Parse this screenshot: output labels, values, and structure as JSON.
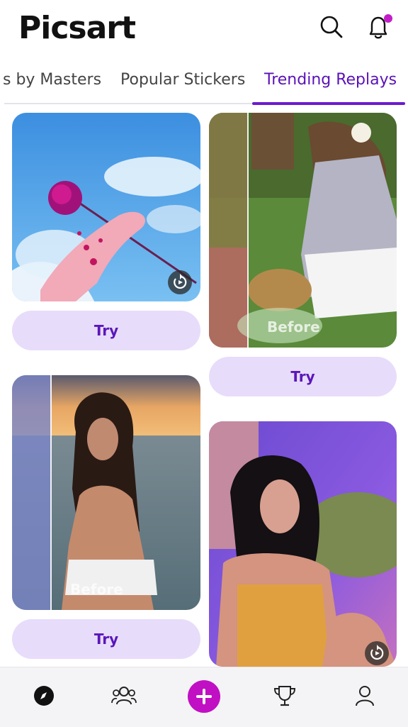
{
  "app": {
    "logo": "Picsart"
  },
  "header": {
    "search_icon": "search-icon",
    "notification_icon": "bell-icon",
    "notification_dot_color": "#c21ec7"
  },
  "tabs": [
    {
      "label": "s by Masters",
      "active": false
    },
    {
      "label": "Popular Stickers",
      "active": false
    },
    {
      "label": "Trending Replays",
      "active": true
    }
  ],
  "accent_color": "#6a1ccc",
  "cards": [
    {
      "try_label": "Try"
    },
    {
      "try_label": "Try",
      "before_label": "Before"
    },
    {
      "try_label": "Try",
      "before_label": "Before"
    },
    {
      "try_label": ""
    }
  ],
  "bottom_nav": [
    {
      "icon": "compass-icon"
    },
    {
      "icon": "people-icon"
    },
    {
      "icon": "plus-icon",
      "color": "#c10fc4"
    },
    {
      "icon": "trophy-icon"
    },
    {
      "icon": "profile-icon"
    }
  ]
}
